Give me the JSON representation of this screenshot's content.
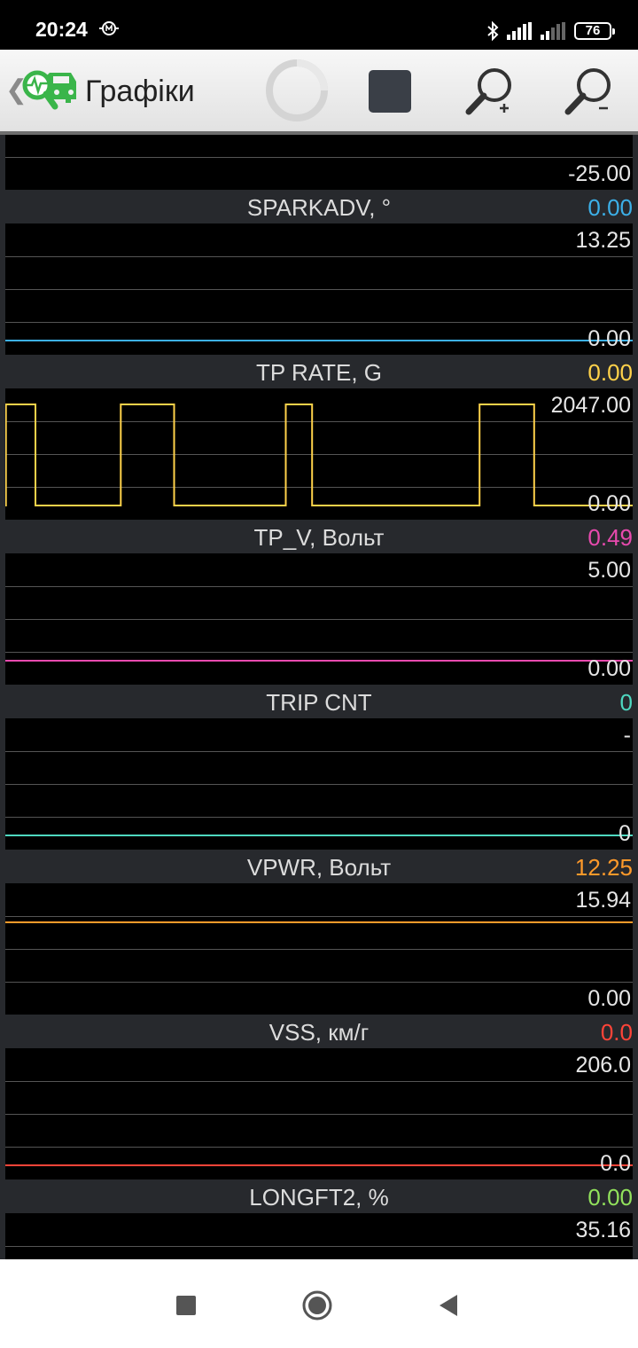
{
  "status_bar": {
    "time": "20:24",
    "battery": "76"
  },
  "app_bar": {
    "title": "Графіки"
  },
  "icons": {
    "back": "chevron-left-icon",
    "logo": "car-diagnostics-icon",
    "spinner": "loading-spinner-icon",
    "stop": "stop-icon",
    "zoom_in": "zoom-in-icon",
    "zoom_out": "zoom-out-icon",
    "bluetooth": "bluetooth-icon",
    "signal": "signal-icon",
    "battery": "battery-icon",
    "nav_recents": "recents-square-icon",
    "nav_home": "home-circle-icon",
    "nav_back": "back-triangle-icon"
  },
  "colors": {
    "green": "#7fe07f",
    "blue": "#3cb0e8",
    "yellow": "#ffd24a",
    "magenta": "#e84aae",
    "cyan": "#4ed8c0",
    "orange": "#ff9a2a",
    "red": "#ff4438",
    "lime": "#92e25c"
  },
  "chart_data": [
    {
      "type": "line",
      "partial": true,
      "ymin_label": "-25.00",
      "series": [
        {
          "color": "#7fe07f",
          "values": [
            0,
            0
          ]
        }
      ]
    },
    {
      "type": "line",
      "title": "SPARKADV, °",
      "current": "0.00",
      "ymax_label": "13.25",
      "ymin_label": "0.00",
      "ylim": [
        0,
        13.25
      ],
      "series": [
        {
          "color": "#3cb0e8",
          "values": [
            0,
            0
          ]
        }
      ]
    },
    {
      "type": "line",
      "title": "TP RATE, G",
      "current": "0.00",
      "ymax_label": "2047.00",
      "ymin_label": "0.00",
      "ylim": [
        0,
        2047
      ],
      "series": [
        {
          "color": "#ffd24a",
          "x": [
            0,
            0.001,
            0.001,
            0.048,
            0.048,
            0.184,
            0.184,
            0.269,
            0.269,
            0.447,
            0.447,
            0.489,
            0.489,
            0.756,
            0.756,
            0.843,
            0.843,
            1
          ],
          "values": [
            0,
            0,
            2047,
            2047,
            0,
            0,
            2047,
            2047,
            0,
            0,
            2047,
            2047,
            0,
            0,
            2047,
            2047,
            0,
            0
          ]
        }
      ]
    },
    {
      "type": "line",
      "title": "TP_V, Вольт",
      "current": "0.49",
      "ymax_label": "5.00",
      "ymin_label": "0.00",
      "ylim": [
        0,
        5
      ],
      "series": [
        {
          "color": "#e84aae",
          "values": [
            0.49,
            0.49
          ]
        }
      ]
    },
    {
      "type": "line",
      "title": "TRIP CNT",
      "current": "0",
      "ymax_label": "-",
      "ymin_label": "0",
      "ylim": [
        0,
        1
      ],
      "series": [
        {
          "color": "#4ed8c0",
          "values": [
            0,
            0
          ]
        }
      ]
    },
    {
      "type": "line",
      "title": "VPWR, Вольт",
      "current": "12.25",
      "ymax_label": "15.94",
      "ymin_label": "0.00",
      "ylim": [
        0,
        15.94
      ],
      "series": [
        {
          "color": "#ff9a2a",
          "values": [
            12.25,
            12.25
          ]
        }
      ]
    },
    {
      "type": "line",
      "title": "VSS, км/г",
      "current": "0.0",
      "ymax_label": "206.0",
      "ymin_label": "0.0",
      "ylim": [
        0,
        206
      ],
      "series": [
        {
          "color": "#ff4438",
          "values": [
            0,
            0
          ]
        }
      ]
    },
    {
      "type": "line",
      "partial": true,
      "title": "LONGFT2, %",
      "current": "0.00",
      "ymax_label": "35.16",
      "series": [
        {
          "color": "#92e25c",
          "values": []
        }
      ]
    }
  ]
}
